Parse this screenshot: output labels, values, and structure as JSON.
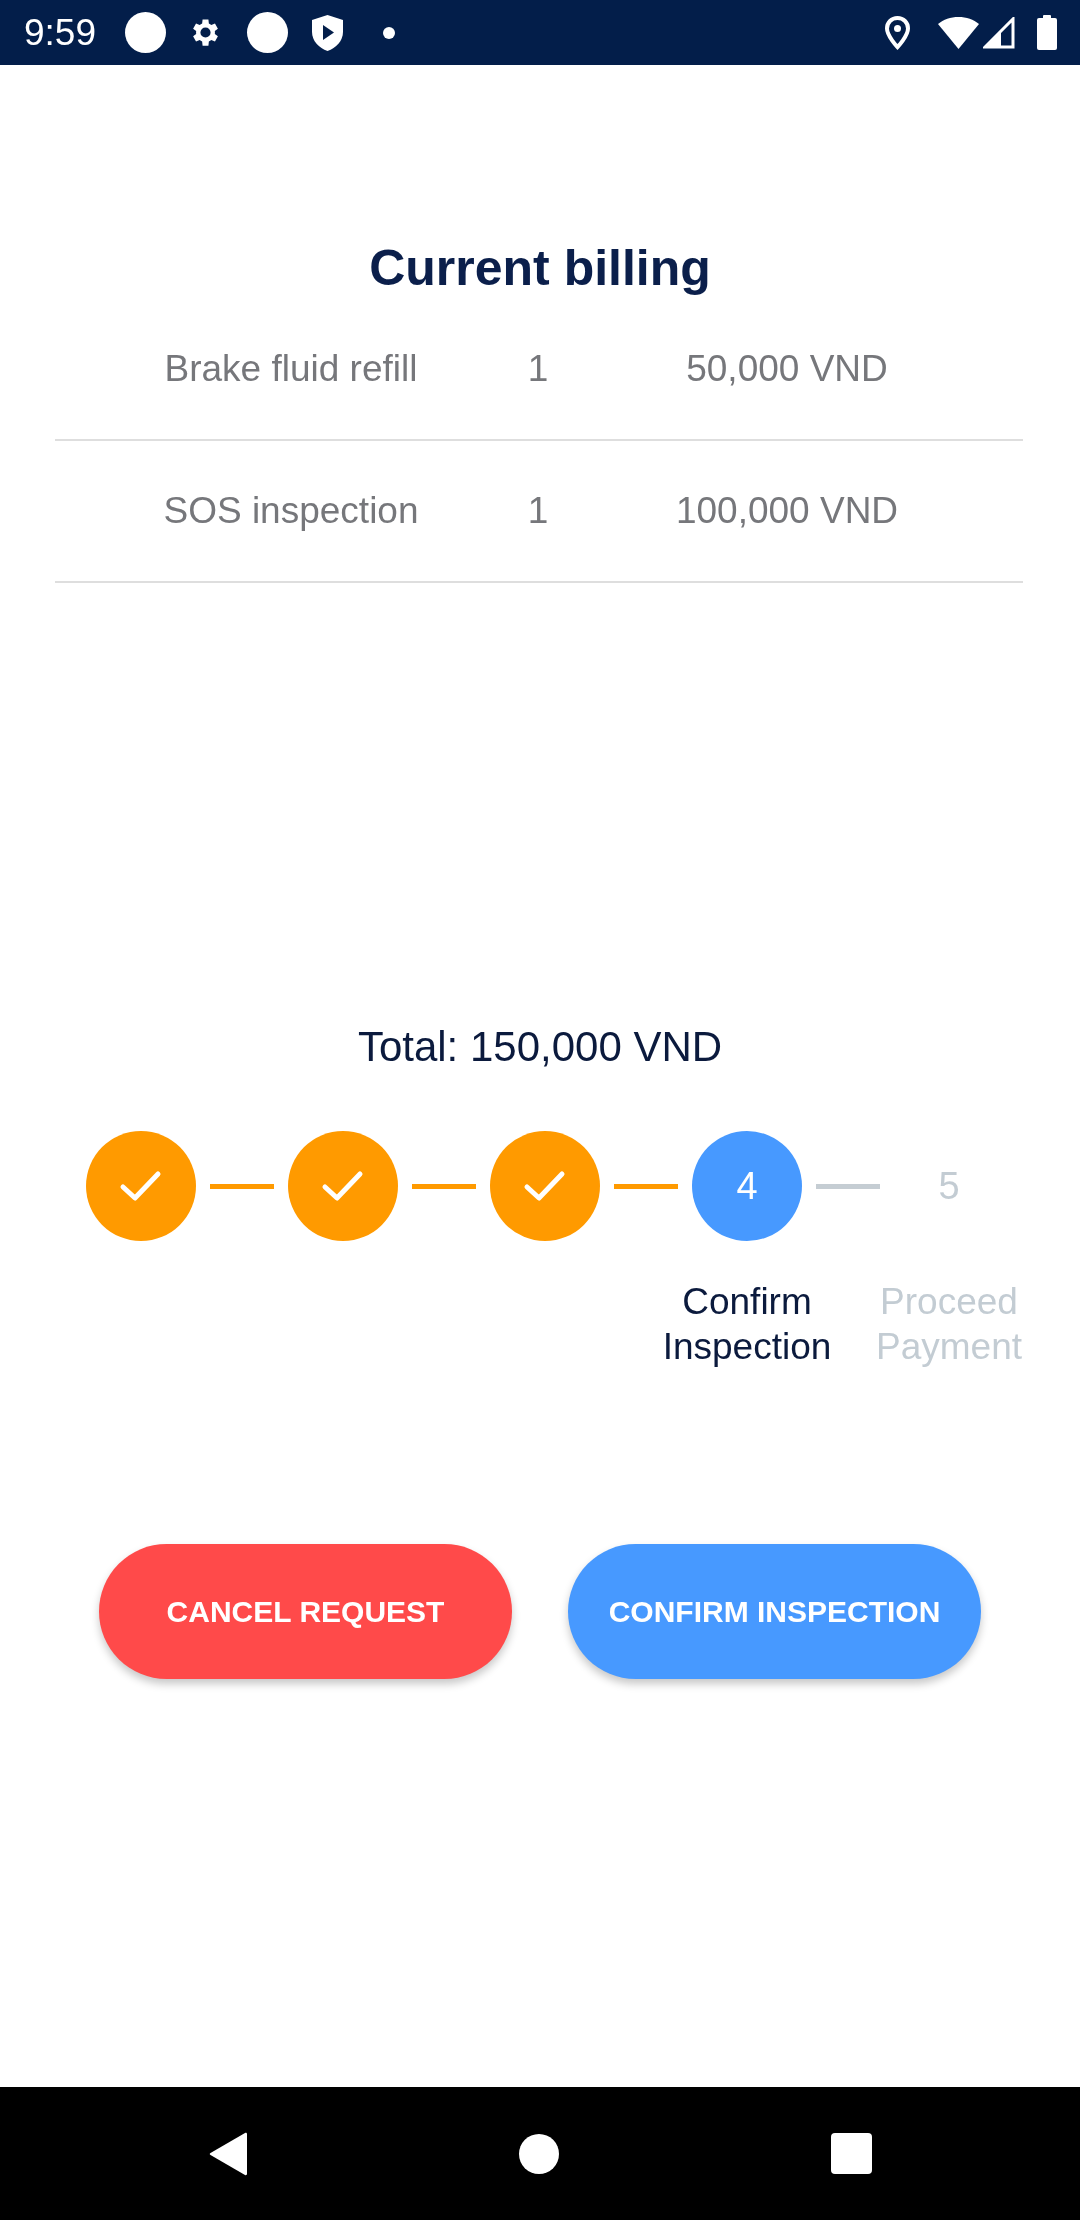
{
  "status_bar": {
    "time": "9:59"
  },
  "billing": {
    "title": "Current billing",
    "rows": [
      {
        "item": "Brake fluid refill",
        "quantity": "1",
        "price": "50,000 VND"
      },
      {
        "item": "SOS inspection",
        "quantity": "1",
        "price": "100,000 VND"
      }
    ]
  },
  "total": "Total: 150,000 VND",
  "stepper": {
    "steps": [
      {
        "completed": true,
        "active": false
      },
      {
        "completed": true,
        "active": false
      },
      {
        "completed": true,
        "active": false
      },
      {
        "completed": false,
        "active": true,
        "number": "4",
        "label": "Confirm Inspection"
      },
      {
        "completed": false,
        "active": false,
        "number": "5",
        "label": "Proceed Payment"
      }
    ]
  },
  "buttons": [
    {
      "kind": "danger",
      "label": "CANCEL REQUEST"
    },
    {
      "kind": "primary",
      "label": "CONFIRM INSPECTION"
    }
  ]
}
